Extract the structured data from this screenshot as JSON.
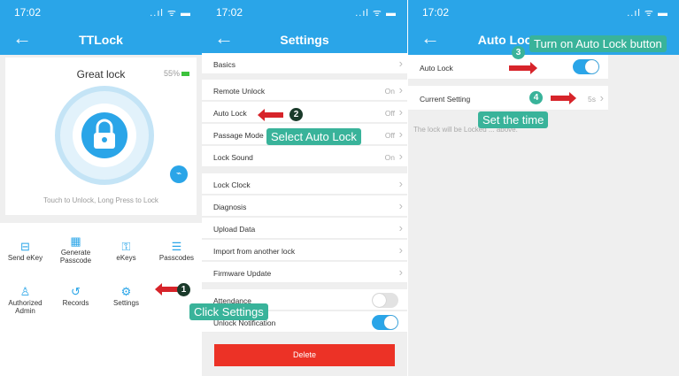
{
  "status": {
    "time": "17:02",
    "signal": "..ıl ᯤ ▬"
  },
  "panel1": {
    "title": "TTLock",
    "lock_name": "Great lock",
    "battery": "55%",
    "hint": "Touch to Unlock, Long Press to Lock",
    "actions": [
      "Send eKey",
      "Generate Passcode",
      "eKeys",
      "Passcodes",
      "Authorized Admin",
      "Records",
      "Settings"
    ]
  },
  "panel2": {
    "title": "Settings",
    "rows": [
      {
        "label": "Basics",
        "value": ""
      },
      {
        "label": "Remote Unlock",
        "value": "On"
      },
      {
        "label": "Auto Lock",
        "value": "Off"
      },
      {
        "label": "Passage Mode",
        "value": "Off"
      },
      {
        "label": "Lock Sound",
        "value": "On"
      },
      {
        "label": "Lock Clock",
        "value": ""
      },
      {
        "label": "Diagnosis",
        "value": ""
      },
      {
        "label": "Upload Data",
        "value": ""
      },
      {
        "label": "Import from another lock",
        "value": ""
      },
      {
        "label": "Firmware Update",
        "value": ""
      },
      {
        "label": "Attendance",
        "value": ""
      },
      {
        "label": "Unlock Notification",
        "value": ""
      }
    ],
    "delete_label": "Delete"
  },
  "panel3": {
    "title": "Auto Lock",
    "auto_lock_label": "Auto Lock",
    "current_setting_label": "Current Setting",
    "current_setting_value": "5s",
    "note": "The lock will be Locked ... above."
  },
  "annotations": {
    "step1": "1",
    "step2": "2",
    "step3": "3",
    "step4": "4",
    "click_settings": "Click Settings",
    "select_auto_lock": "Select Auto Lock",
    "turn_on": "Turn on Auto Lock button",
    "set_time": "Set the time"
  },
  "colors": {
    "brand": "#2aa5e8",
    "annotation": "#39b39a",
    "arrow": "#d7242a",
    "delete": "#ec3226"
  }
}
